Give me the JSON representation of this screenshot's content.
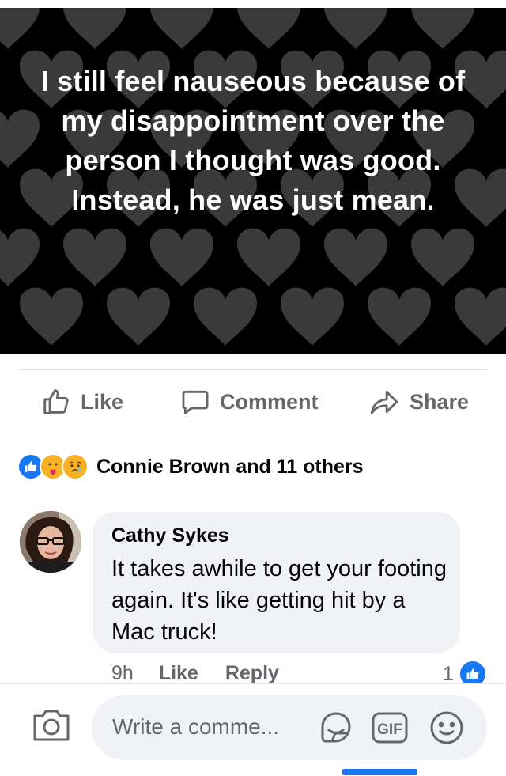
{
  "post": {
    "quote_text": "I still feel nauseous because of my disappointment over the person I thought was good. Instead, he was just mean.",
    "background_color": "#000000",
    "heart_color": "#3a3a3a"
  },
  "actions": {
    "like_label": "Like",
    "comment_label": "Comment",
    "share_label": "Share"
  },
  "reactions": {
    "icons": [
      "like-icon",
      "care-icon",
      "sad-icon"
    ],
    "summary": "Connie Brown and 11 others"
  },
  "comment": {
    "author": "Cathy Sykes",
    "text": "It takes awhile to get your footing again. It's like getting hit by a Mac truck!",
    "time": "9h",
    "like_label": "Like",
    "reply_label": "Reply",
    "like_count": "1"
  },
  "composer": {
    "placeholder": "Write a comme...",
    "gif_label": "GIF"
  },
  "colors": {
    "accent": "#1877f2",
    "muted_text": "#65676b",
    "bubble_bg": "#f0f2f5"
  }
}
